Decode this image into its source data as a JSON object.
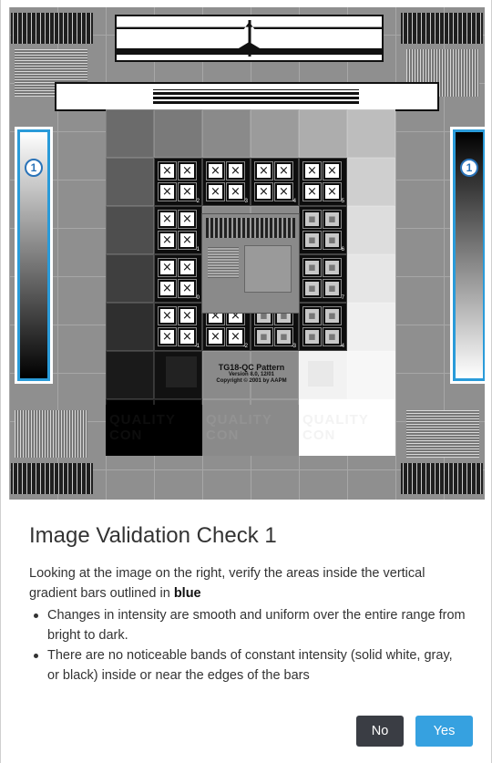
{
  "pattern": {
    "badge_number": "1",
    "copyright_title": "TG18-QC Pattern",
    "copyright_version": "Version 8.0, 12/01",
    "copyright_text": "Copyright © 2001 by AAPM",
    "qc_text": [
      "QUALITY CON",
      "QUALITY CON",
      "QUALITY CON"
    ],
    "cell_numbers": [
      "2",
      "3",
      "4",
      "5",
      "1",
      "6",
      "0",
      "7",
      "-1",
      "-2",
      "-3",
      "-4"
    ]
  },
  "dialog": {
    "title": "Image Validation Check 1",
    "description_prefix": "Looking at the image on the right, verify the areas inside the vertical gradient bars outlined in ",
    "description_emphasis": "blue",
    "bullets": [
      "Changes in intensity are smooth and uniform over the entire range from bright to dark.",
      "There are no noticeable bands of constant intensity (solid white, gray, or black) inside or near the edges of the bars"
    ],
    "no_label": "No",
    "yes_label": "Yes"
  },
  "colors": {
    "accent_blue": "#2a9bd9",
    "no_button": "#3a3d44",
    "yes_button": "#36a1e0"
  }
}
